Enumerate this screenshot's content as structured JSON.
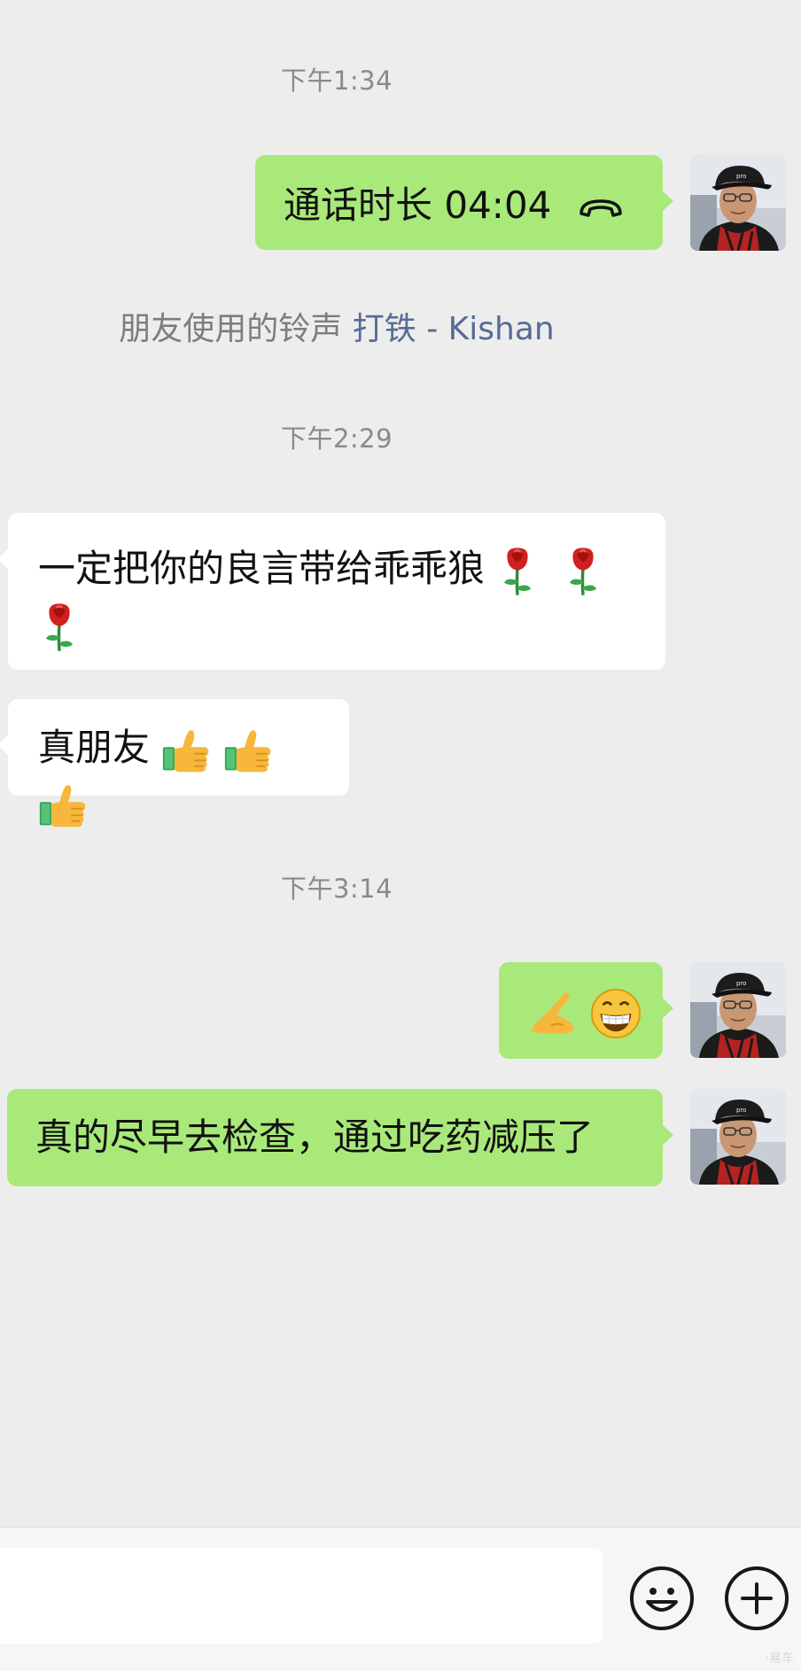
{
  "messages": {
    "ts1": "下午1:34",
    "call_text": "通话时长 04:04",
    "ringtone_prefix": "朋友使用的铃声",
    "ringtone_link": "打铁 - Kishan",
    "ts2": "下午2:29",
    "msg1_text": "一定把你的良言带给乖乖狼",
    "msg2_text": "真朋友",
    "ts3": "下午3:14",
    "msg4_text": "真的尽早去检查，通过吃药减压了"
  },
  "input": {
    "placeholder": ""
  },
  "colors": {
    "background": "#ededed",
    "outgoing_bubble": "#a9e97a",
    "incoming_bubble": "#ffffff",
    "link": "#576b95",
    "timestamp": "#8a8a8a"
  },
  "icons": {
    "call": "phone-hangup-icon",
    "rose": "rose-emoji-icon",
    "thumbs_up": "thumbs-up-emoji-icon",
    "ok_hand": "ok-hand-emoji-icon",
    "grin": "grin-emoji-icon",
    "emoji_button": "smiley-icon",
    "more_button": "plus-icon"
  },
  "watermark": "·易车"
}
